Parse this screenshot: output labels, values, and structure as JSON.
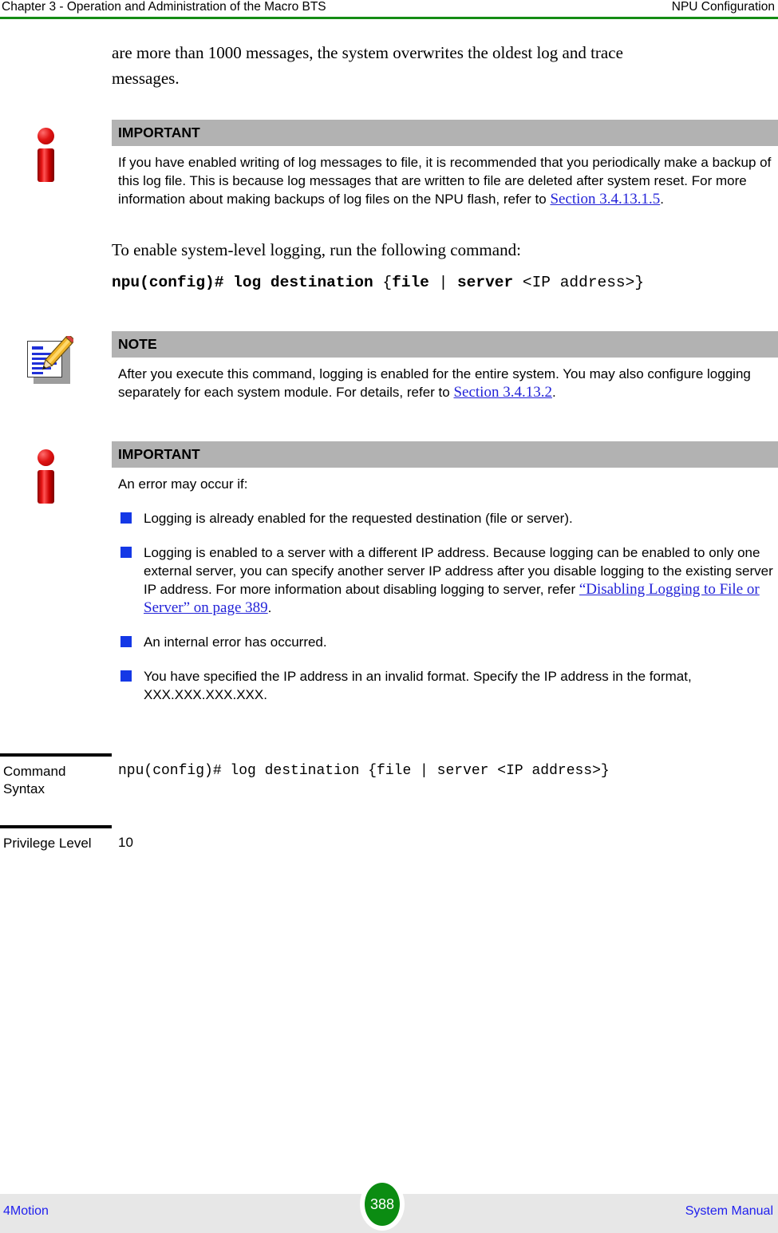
{
  "header": {
    "left": "Chapter 3 - Operation and Administration of the Macro BTS",
    "right": "NPU Configuration",
    "rule_color": "#148c14"
  },
  "intro_paragraph": "are more than 1000 messages, the system overwrites the oldest log and trace messages.",
  "important_box_1": {
    "icon": "info-icon",
    "title": "IMPORTANT",
    "text": "If you have enabled writing of log messages to file, it is recommended that you periodically make a backup of this log file. This is because log messages that are written to file are deleted after system reset. For more information about making backups of log files on the NPU flash, refer to ",
    "link": "Section 3.4.13.1.5",
    "text_after": "."
  },
  "enable_paragraph": "To enable system-level logging, run the following command:",
  "cli_command": {
    "segments": [
      {
        "text": "npu(config)# log destination ",
        "bold": true
      },
      {
        "text": "{",
        "bold": false
      },
      {
        "text": "file",
        "bold": true
      },
      {
        "text": " | ",
        "bold": false
      },
      {
        "text": "server",
        "bold": true
      },
      {
        "text": " <IP address>}",
        "bold": false
      }
    ],
    "plain": "npu(config)# log destination {file | server <IP address>}"
  },
  "note_box": {
    "icon": "note-pencil-icon",
    "title": "NOTE",
    "text": "After you execute this command, logging is enabled for the entire system. You may also configure logging separately for each system module. For details, refer to ",
    "link": "Section 3.4.13.2",
    "text_after": "."
  },
  "important_box_2": {
    "icon": "info-icon",
    "title": "IMPORTANT",
    "intro": "An error may occur if:",
    "bullets": [
      {
        "text": "Logging is already enabled for the requested destination (file or server).",
        "link": "",
        "text_after": ""
      },
      {
        "text": "Logging is enabled to a server with a different IP address. Because logging can be enabled to only one external server, you can specify another server IP address after you disable logging to the existing server IP address. For more information about disabling logging to server, refer ",
        "link": "“Disabling Logging to File or Server” on page 389",
        "text_after": "."
      },
      {
        "text": "An internal error has occurred.",
        "link": "",
        "text_after": ""
      },
      {
        "text": "You have specified the IP address in an invalid format. Specify the IP address in the format, XXX.XXX.XXX.XXX.",
        "link": "",
        "text_after": ""
      }
    ],
    "bullet_color": "#1438e6"
  },
  "command_table": {
    "rows": [
      {
        "label": "Command Syntax",
        "value": "npu(config)# log destination {file | server <IP address>}",
        "mono": true
      },
      {
        "label": "Privilege Level",
        "value": "10",
        "mono": false
      }
    ]
  },
  "footer": {
    "left": "4Motion",
    "page": "388",
    "right": "System Manual",
    "page_badge_color": "#0b8c12",
    "link_color": "#2020ee"
  }
}
